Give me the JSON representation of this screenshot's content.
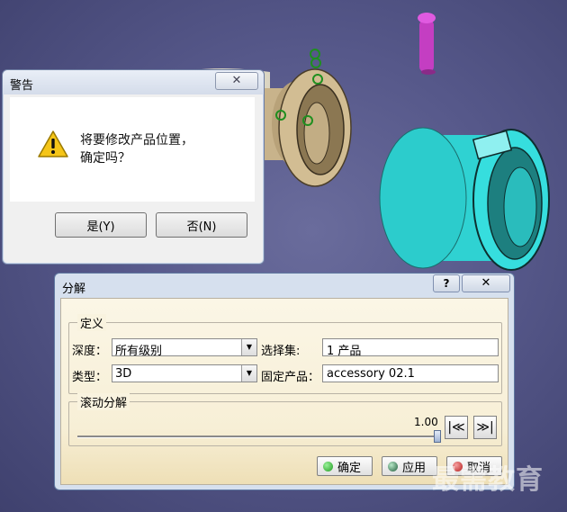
{
  "warning_dialog": {
    "title": "警告",
    "close_glyph": "✕",
    "message_line1": "将要修改产品位置，",
    "message_line2": "确定吗？",
    "yes_label": "是(Y)",
    "no_label": "否(N)",
    "icon": "warning-icon"
  },
  "explode_dialog": {
    "title": "分解",
    "help_glyph": "?",
    "close_glyph": "✕",
    "definition_group": "定义",
    "depth_label": "深度：",
    "depth_value": "所有级别",
    "selection_label": "选择集:",
    "selection_value": "1 产品",
    "type_label": "类型：",
    "type_value": "3D",
    "fixed_product_label": "固定产品：",
    "fixed_product_value": "accessory 02.1",
    "scroll_group": "滚动分解",
    "slider_value_text": "1.00",
    "slider_level": 1.0,
    "first_glyph": "|≪",
    "last_glyph": "≫|",
    "ok_label": "确定",
    "apply_label": "应用",
    "cancel_label": "取消"
  },
  "watermark": "最需教育",
  "colors": {
    "viewport_bg": "#56588a",
    "cyan_part": "#33d6d6",
    "bronze_part": "#c9b48a",
    "pin": "#cc3fc8",
    "ok_dot": "#2bb52b",
    "apply_dot": "#2e7d4f",
    "cancel_dot": "#d12b2b"
  }
}
